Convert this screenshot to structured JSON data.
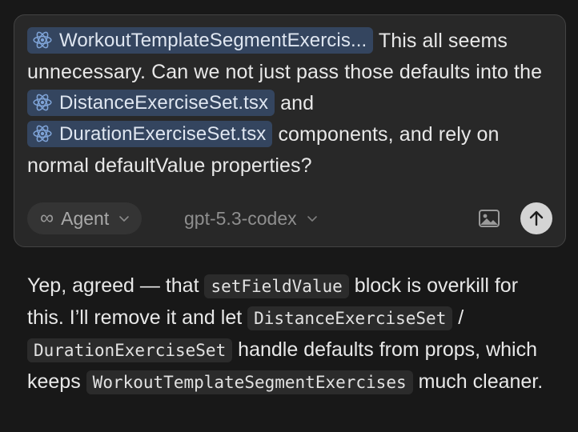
{
  "composer": {
    "file_chips": [
      "WorkoutTemplateSegmentExercis...",
      "DistanceExerciseSet.tsx",
      "DurationExerciseSet.tsx"
    ],
    "text_1": "This all seems unnecessary. Can we not just pass those defaults into the",
    "text_2": "and",
    "text_3": "components, and rely on normal defaultValue properties?",
    "agent_mode": "Agent",
    "model": "gpt-5.3-codex"
  },
  "icons": {
    "file_chip": "react-icon",
    "agent_mode": "infinity-icon",
    "dropdown": "chevron-down-icon",
    "attach": "image-icon",
    "send": "arrow-up-icon"
  },
  "reply": {
    "t1": "Yep, agreed — that",
    "c1": "setFieldValue",
    "t2": "block is overkill for this. I’ll remove it and let",
    "c2": "DistanceExerciseSet",
    "t3": "/",
    "c3": "DurationExerciseSet",
    "t4": "handle defaults from props, which keeps",
    "c4": "WorkoutTemplateSegmentExercises",
    "t5": "much cleaner."
  },
  "colors": {
    "background": "#181818",
    "composer": "#282828",
    "chip": "#34455f",
    "react_icon": "#7fa4d8",
    "send_button": "#d4d4d4"
  }
}
